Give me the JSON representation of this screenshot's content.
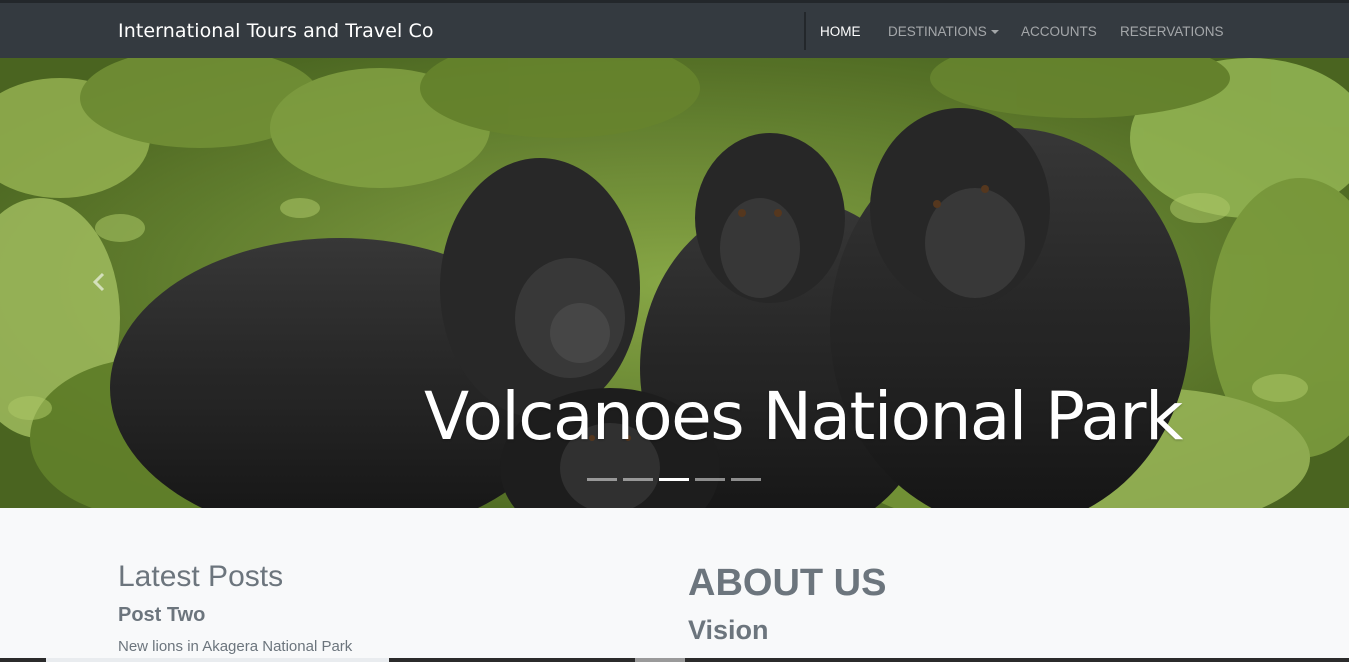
{
  "navbar": {
    "brand": "International Tours and Travel Co",
    "links": [
      {
        "label": "HOME",
        "active": true
      },
      {
        "label": "DESTINATIONS",
        "dropdown": true
      },
      {
        "label": "ACCOUNTS"
      },
      {
        "label": "RESERVATIONS"
      }
    ]
  },
  "carousel": {
    "caption": "Volcanoes National Park",
    "indicator_count": 5,
    "active_indicator": 3
  },
  "latest_posts": {
    "title": "Latest Posts",
    "post_title": "Post Two",
    "post_text": "New lions in Akagera National Park"
  },
  "about": {
    "title": "ABOUT US",
    "vision": "Vision"
  },
  "colors": {
    "navbar": "#343a40",
    "page_bg": "#f8f9fa",
    "muted_text": "#6c757d"
  }
}
